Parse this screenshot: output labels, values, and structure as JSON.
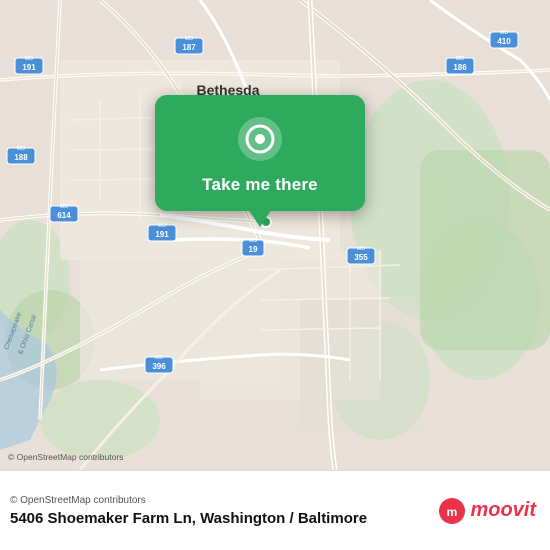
{
  "map": {
    "attribution": "© OpenStreetMap contributors",
    "center_label": "Bethesda",
    "road_labels": [
      "MD 191",
      "MD 187",
      "MD 188",
      "MD 410",
      "MD 186",
      "MD 614",
      "MD 191",
      "MD 355",
      "MD 396",
      "MD 19"
    ],
    "bg_color": "#e8e0d8"
  },
  "popup": {
    "button_label": "Take me there",
    "bg_color": "#2eaa5e"
  },
  "bottom_bar": {
    "attribution": "© OpenStreetMap contributors",
    "address": "5406 Shoemaker Farm Ln, Washington / Baltimore",
    "brand": "moovit"
  }
}
